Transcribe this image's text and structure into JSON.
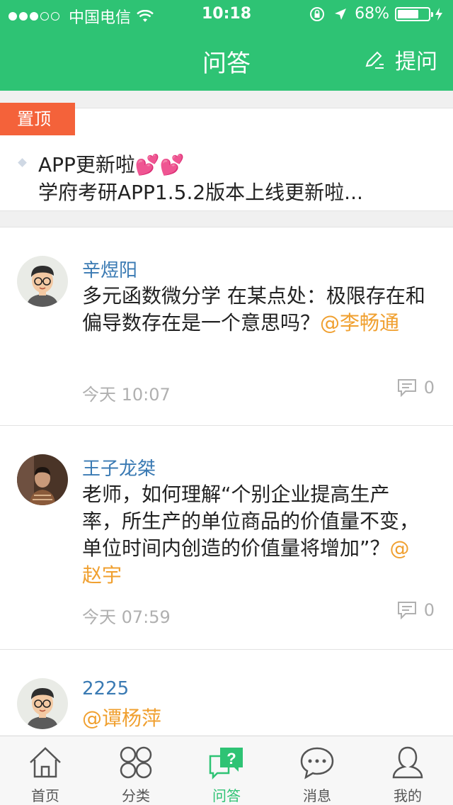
{
  "status_bar": {
    "carrier": "中国电信",
    "time": "10:18",
    "battery_percent": "68%",
    "battery_level": 0.68,
    "signal_bars": 3,
    "signal_max": 5
  },
  "nav": {
    "title": "问答",
    "ask_label": "提问",
    "accent_color": "#2ec374"
  },
  "pinned": {
    "badge": "置顶",
    "title": "APP更新啦💕💕",
    "subtitle": "学府考研APP1.5.2版本上线更新啦..."
  },
  "posts": [
    {
      "user": "辛煜阳",
      "text": "多元函数微分学 在某点处：极限存在和偏导数存在是一个意思吗？",
      "mention": "@李畅通",
      "time": "今天 10:07",
      "comments": "0"
    },
    {
      "user": "王子龙桀",
      "text": "老师，如何理解“个别企业提高生产率，所生产的单位商品的价值量不变，单位时间内创造的价值量将增加”？",
      "mention": "@赵宇",
      "time": "今天 07:59",
      "comments": "0"
    },
    {
      "user": "2225",
      "text": "",
      "mention": "@谭杨萍",
      "time": "",
      "comments": ""
    }
  ],
  "tabs": [
    {
      "label": "首页",
      "icon": "home-icon"
    },
    {
      "label": "分类",
      "icon": "category-icon"
    },
    {
      "label": "问答",
      "icon": "qa-icon",
      "active": true
    },
    {
      "label": "消息",
      "icon": "message-icon"
    },
    {
      "label": "我的",
      "icon": "profile-icon"
    }
  ]
}
